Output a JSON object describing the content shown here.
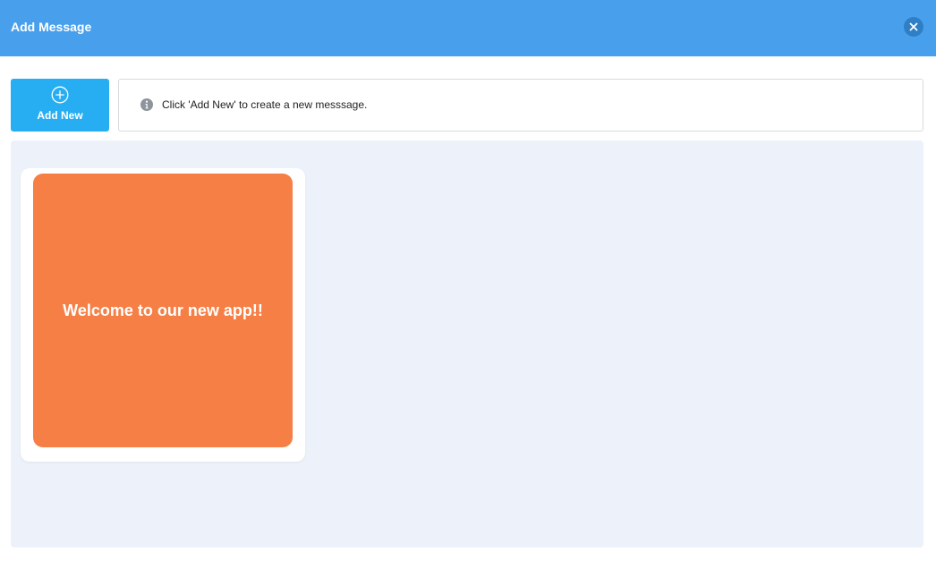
{
  "header": {
    "title": "Add Message",
    "close_icon": "close-icon",
    "bg_color": "#48a0ec"
  },
  "toolbar": {
    "add_new_label": "Add New",
    "add_new_icon": "plus-circle-icon",
    "add_new_color": "#27aef2"
  },
  "info": {
    "icon": "info-icon",
    "text": "Click 'Add New' to create a new messsage."
  },
  "messages": {
    "panel_color": "#edf2fa",
    "items": [
      {
        "text": "Welcome to our new app!!",
        "bg_color": "#f57f45"
      }
    ]
  }
}
